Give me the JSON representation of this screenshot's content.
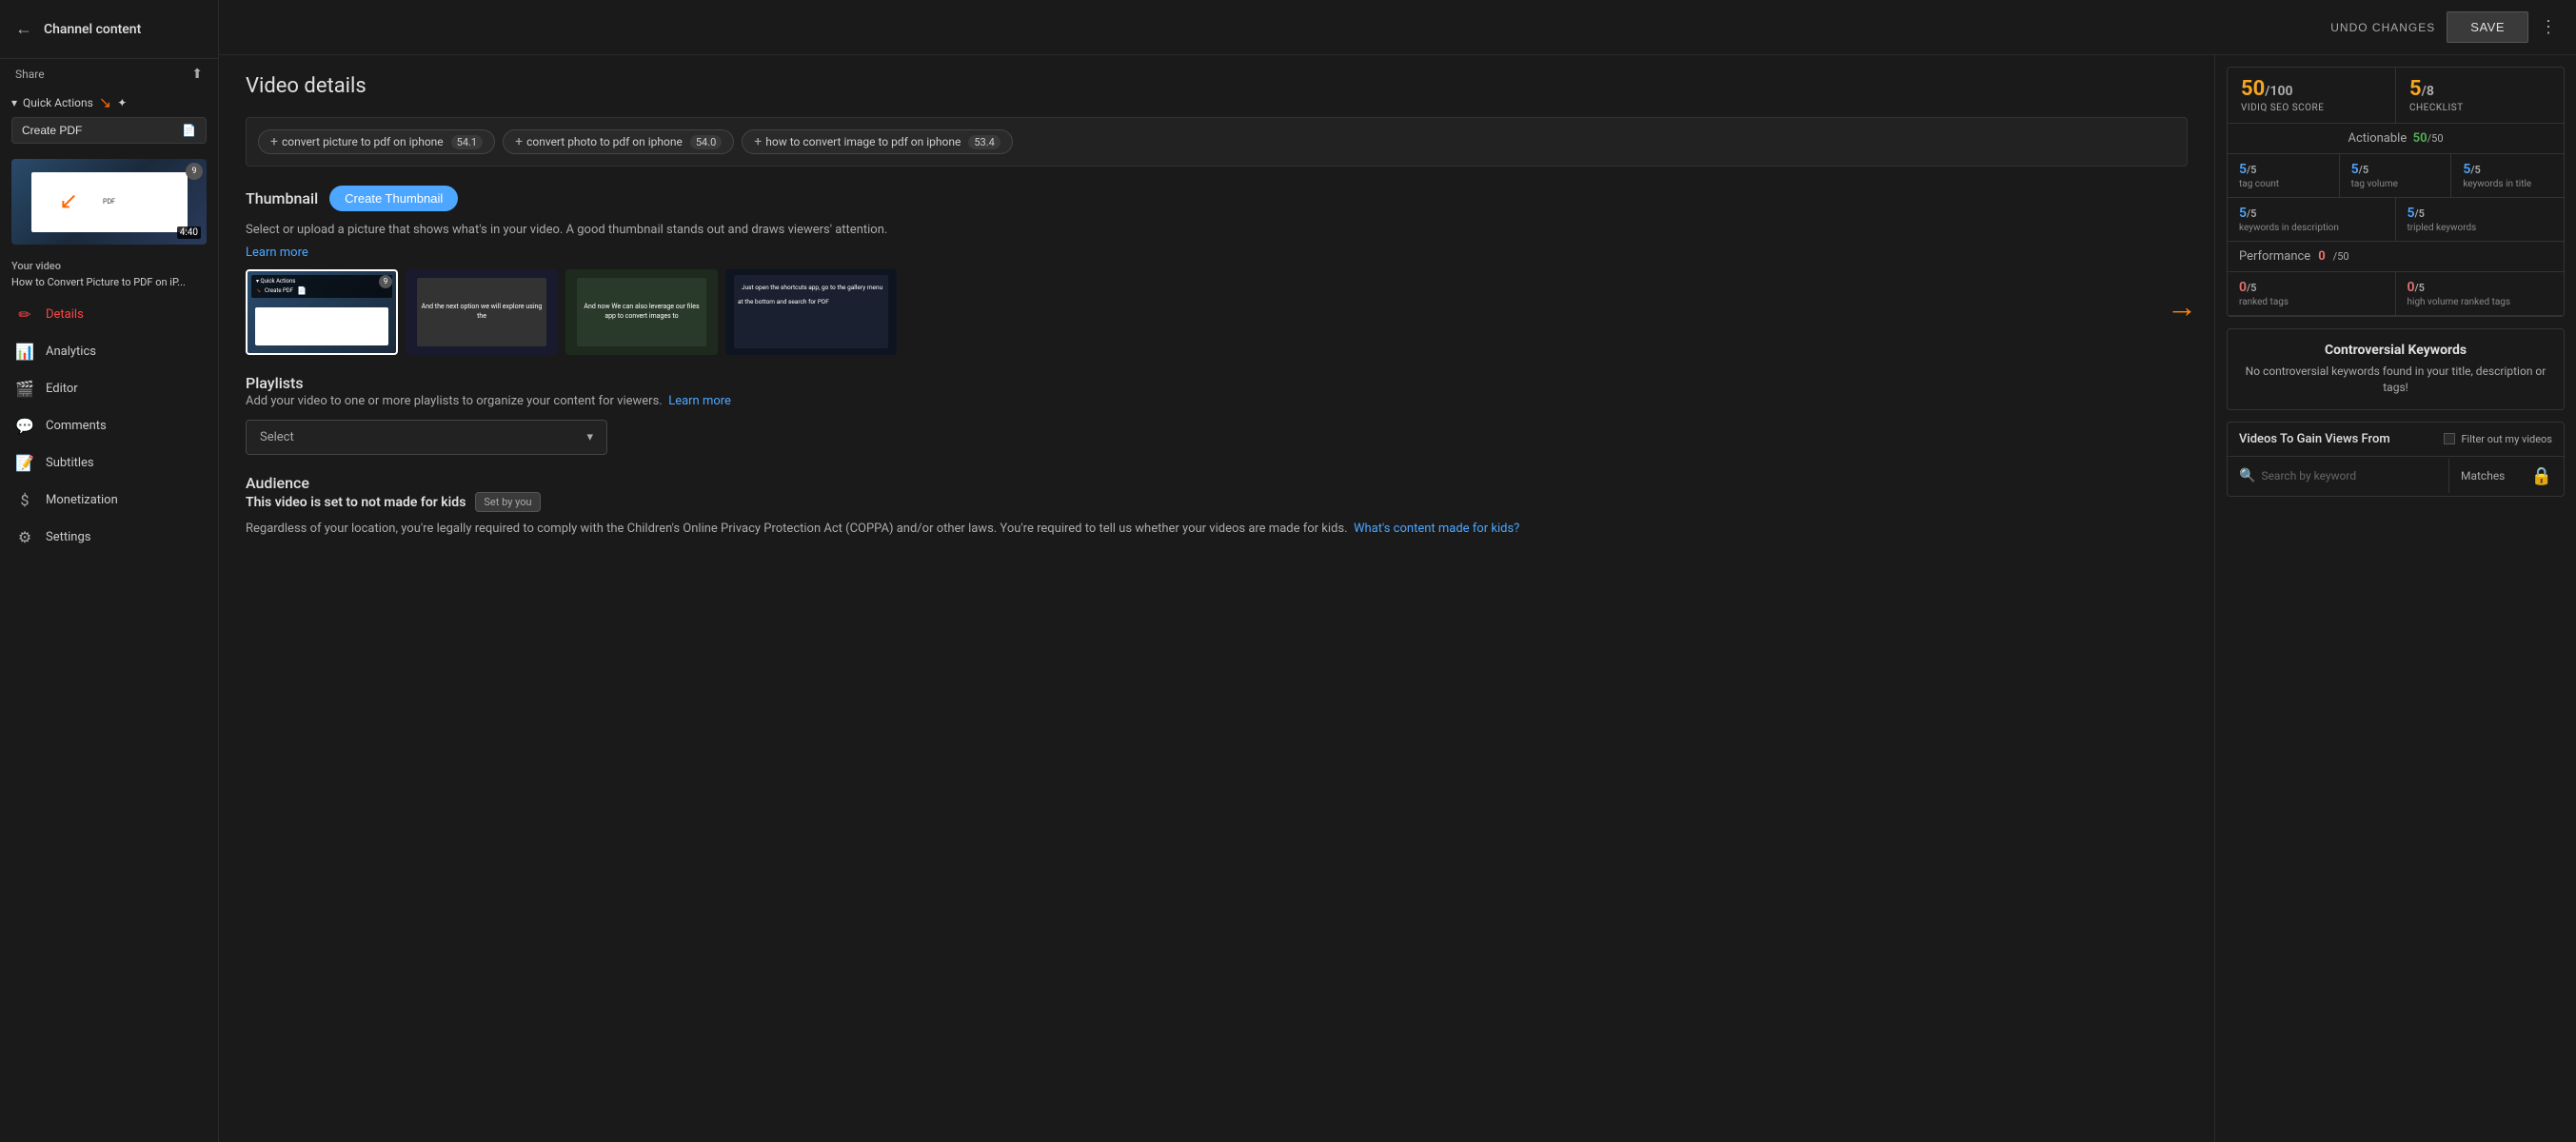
{
  "sidebar": {
    "back_label": "←",
    "title": "Channel content",
    "share_label": "Share",
    "quick_actions_label": "Quick Actions",
    "create_pdf_label": "Create PDF",
    "your_video_label": "Your video",
    "your_video_title": "How to Convert Picture to PDF on iP...",
    "video_duration": "4:40",
    "video_badge": "9",
    "nav_items": [
      {
        "id": "details",
        "label": "Details",
        "active": true
      },
      {
        "id": "analytics",
        "label": "Analytics",
        "active": false
      },
      {
        "id": "editor",
        "label": "Editor",
        "active": false
      },
      {
        "id": "comments",
        "label": "Comments",
        "active": false
      },
      {
        "id": "subtitles",
        "label": "Subtitles",
        "active": false
      },
      {
        "id": "monetization",
        "label": "Monetization",
        "active": false
      },
      {
        "id": "settings",
        "label": "Settings",
        "active": false
      }
    ]
  },
  "header": {
    "undo_label": "UNDO CHANGES",
    "save_label": "SAVE"
  },
  "main": {
    "title": "Video details",
    "tags": [
      {
        "text": "convert picture to pdf on iphone",
        "score": "54.1"
      },
      {
        "text": "convert photo to pdf on iphone",
        "score": "54.0"
      },
      {
        "text": "how to convert image to pdf on iphone",
        "score": "53.4"
      }
    ],
    "thumbnail": {
      "section_title": "Thumbnail",
      "create_btn": "Create Thumbnail",
      "description": "Select or upload a picture that shows what's in your video. A good thumbnail stands out and draws viewers' attention.",
      "learn_more": "Learn more"
    },
    "thumbnails": [
      {
        "id": "t1",
        "type": "quick-actions",
        "label": "Quick Actions / Create PDF"
      },
      {
        "id": "t2",
        "type": "dark-text",
        "label": "And the next option we will explore using the..."
      },
      {
        "id": "t3",
        "type": "files-app",
        "label": "And now We can also leverage our files app to convert images to"
      },
      {
        "id": "t4",
        "type": "shortcuts",
        "label": "Just open the shortcuts app, go to the gallery menu at the bottom and search for PDF"
      }
    ],
    "playlists": {
      "section_title": "Playlists",
      "description": "Add your video to one or more playlists to organize your content for viewers.",
      "learn_more": "Learn more",
      "select_placeholder": "Select"
    },
    "audience": {
      "section_title": "Audience",
      "not_for_kids_label": "This video is set to not made for kids",
      "set_by_you": "Set by you",
      "description": "Regardless of your location, you're legally required to comply with the Children's Online Privacy Protection Act (COPPA) and/or other laws. You're required to tell us whether your videos are made for kids.",
      "whats_content_link": "What's content made for kids?"
    }
  },
  "right_panel": {
    "seo_score": {
      "score": "50",
      "score_total": "100",
      "score_label": "VIDIQ SEO SCORE",
      "checklist_score": "5",
      "checklist_total": "8",
      "checklist_label": "CHECKLIST",
      "actionable_label": "Actionable",
      "actionable_score": "50",
      "actionable_total": "50"
    },
    "metrics": [
      {
        "value": "5",
        "total": "5",
        "label": "tag count"
      },
      {
        "value": "5",
        "total": "5",
        "label": "tag volume"
      },
      {
        "value": "5",
        "total": "5",
        "label": "keywords in title"
      }
    ],
    "metrics2": [
      {
        "value": "5",
        "total": "5",
        "label": "keywords in description"
      },
      {
        "value": "5",
        "total": "5",
        "label": "tripled keywords"
      }
    ],
    "performance_label": "Performance",
    "performance_score": "0",
    "performance_total": "50",
    "metrics3": [
      {
        "value": "0",
        "total": "5",
        "label": "ranked tags"
      },
      {
        "value": "0",
        "total": "5",
        "label": "high volume ranked tags"
      }
    ],
    "controversial": {
      "title": "Controversial Keywords",
      "description": "No controversial keywords found in your title, description or tags!"
    },
    "videos_gain": {
      "title": "Videos To Gain Views From",
      "filter_label": "Filter out my videos",
      "search_placeholder": "Search by keyword",
      "matches_label": "Matches"
    }
  }
}
